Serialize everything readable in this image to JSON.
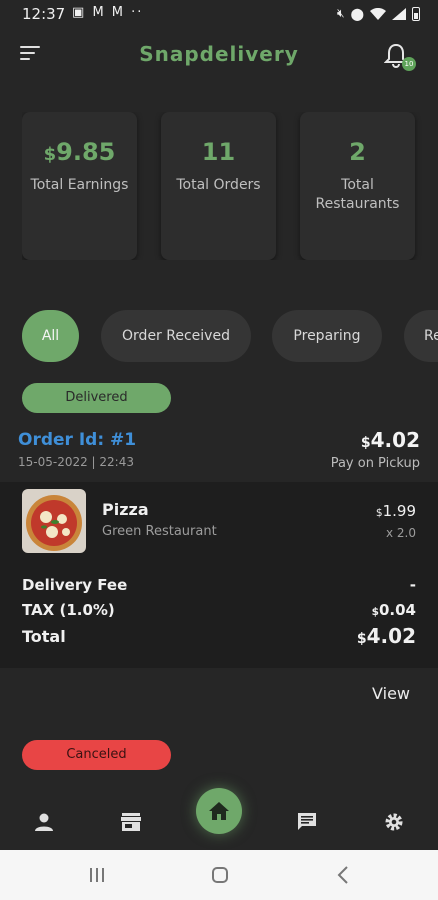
{
  "status_bar": {
    "time": "12:37",
    "left_icons": [
      "gmail-icon",
      "gmail-icon",
      "gmail-icon",
      "more-dots-icon"
    ],
    "right_icons": [
      "mute-icon",
      "location-icon",
      "wifi-icon",
      "signal-icon",
      "battery-icon"
    ]
  },
  "app_bar": {
    "title": "Snapdelivery",
    "notification_count": "10",
    "accent_color": "#6fa86a"
  },
  "stats": [
    {
      "currency": "$",
      "value": "9.85",
      "label": "Total Earnings"
    },
    {
      "currency": "",
      "value": "11",
      "label": "Total Orders"
    },
    {
      "currency": "",
      "value": "2",
      "label": "Total Restaurants"
    }
  ],
  "filters": {
    "items": [
      "All",
      "Order Received",
      "Preparing",
      "Ready"
    ],
    "selected": "All"
  },
  "orders": [
    {
      "status": "Delivered",
      "order_id": "Order Id: #1",
      "date": "15-05-2022 | 22:43",
      "total_currency": "$",
      "total": "4.02",
      "payment": "Pay on Pickup",
      "items": [
        {
          "name": "Pizza",
          "restaurant": "Green Restaurant",
          "currency": "$",
          "price": "1.99",
          "qty": "x 2.0"
        }
      ],
      "summary": {
        "delivery_fee_label": "Delivery Fee",
        "delivery_fee_value": "-",
        "tax_label": "TAX (1.0%)",
        "tax_currency": "$",
        "tax_value": "0.04",
        "total_label": "Total",
        "total_currency": "$",
        "total_value": "4.02"
      },
      "view_label": "View"
    },
    {
      "status": "Canceled"
    }
  ],
  "bottom_nav": [
    "profile-icon",
    "store-icon",
    "home-icon",
    "chat-icon",
    "settings-icon"
  ],
  "system_nav": [
    "recents-icon",
    "home-circle-icon",
    "back-icon"
  ]
}
